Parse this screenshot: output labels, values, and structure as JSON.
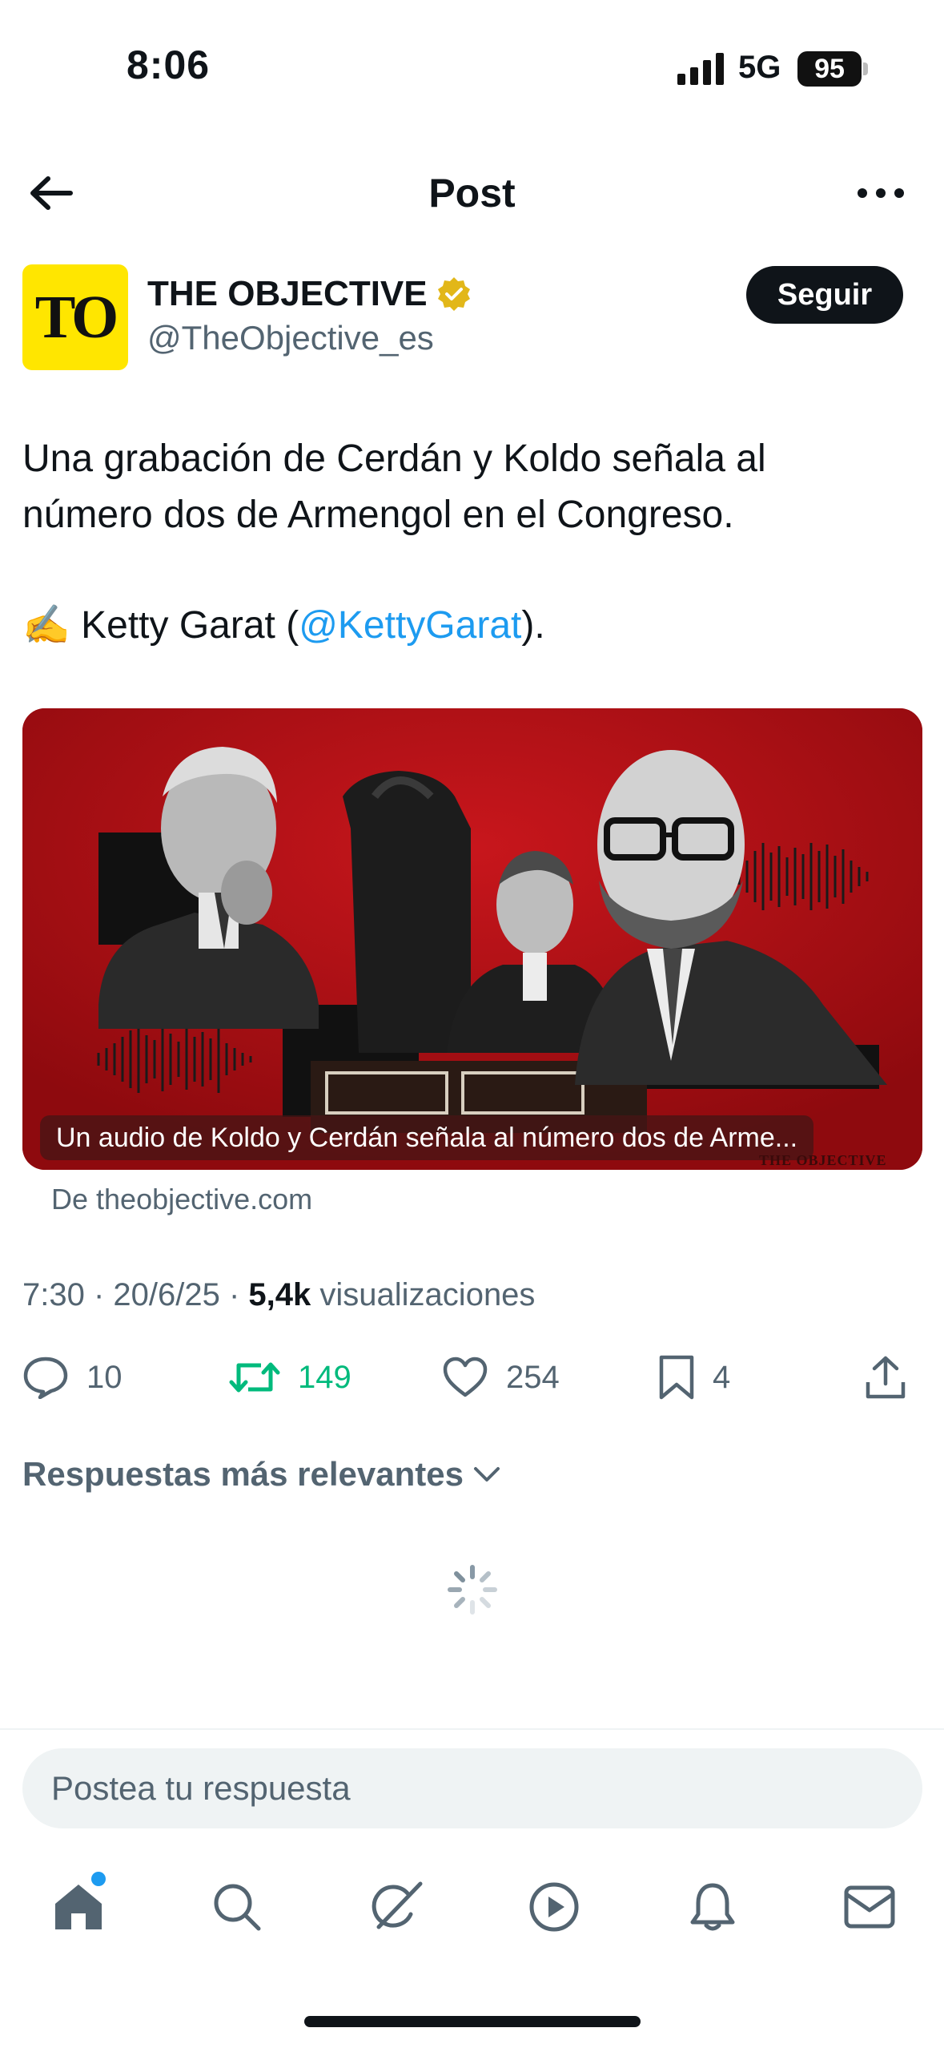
{
  "status_bar": {
    "time": "8:06",
    "network": "5G",
    "battery": "95"
  },
  "header": {
    "title": "Post"
  },
  "author": {
    "name": "THE OBJECTIVE",
    "handle": "@TheObjective_es",
    "avatar_text": "TO",
    "verified": true,
    "follow_label": "Seguir"
  },
  "tweet": {
    "line1": "Una grabación de Cerdán y Koldo señala al",
    "line2": "número dos de Armengol en el Congreso.",
    "line3_emoji": "✍️",
    "line3_prefix": " Ketty Garat (",
    "line3_mention": "@KettyGarat",
    "line3_suffix": ")."
  },
  "media": {
    "caption": "Un audio de Koldo y Cerdán señala al número dos de Arme...",
    "watermark": "THE OBJECTIVE",
    "source": "De theobjective.com"
  },
  "meta": {
    "time": "7:30",
    "date": "20/6/25",
    "views_count": "5,4k",
    "views_label": "visualizaciones"
  },
  "actions": {
    "replies": "10",
    "retweets": "149",
    "likes": "254",
    "bookmarks": "4"
  },
  "replies_sort": {
    "label": "Respuestas más relevantes"
  },
  "reply_bar": {
    "placeholder": "Postea tu respuesta"
  },
  "colors": {
    "accent": "#1d9bf0",
    "retweet": "#00ba7c",
    "media_bg": "#a80d12"
  },
  "tabs": [
    {
      "name": "home",
      "icon": "home-icon",
      "active": true
    },
    {
      "name": "search",
      "icon": "search-icon"
    },
    {
      "name": "grok",
      "icon": "grok-icon"
    },
    {
      "name": "video",
      "icon": "play-icon"
    },
    {
      "name": "notifications",
      "icon": "bell-icon"
    },
    {
      "name": "messages",
      "icon": "mail-icon"
    }
  ]
}
